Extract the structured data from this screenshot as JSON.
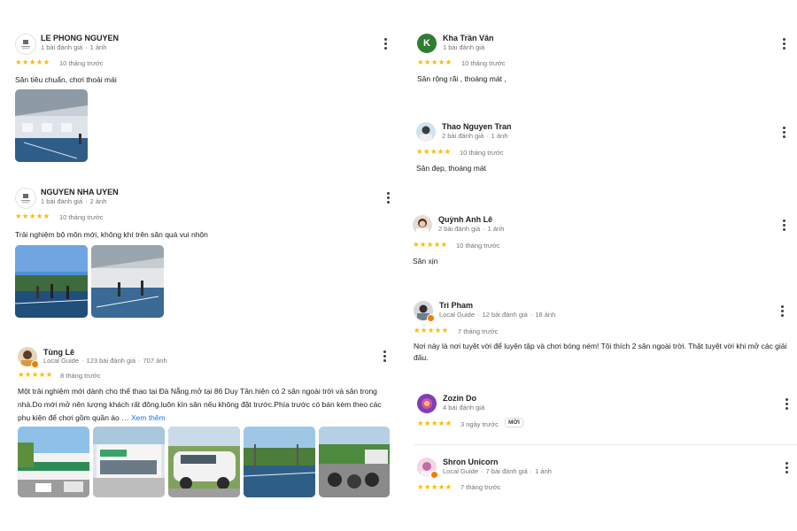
{
  "reviews": [
    {
      "name": "LE PHONG NGUYEN",
      "meta_a": "1 bài đánh giá",
      "meta_b": "1 ảnh",
      "time": "10 tháng trước",
      "stars": "★★★★★",
      "text": "Sân tiêu chuẩn, chơi thoải mái"
    },
    {
      "name": "NGUYEN NHA UYEN",
      "meta_a": "1 bài đánh giá",
      "meta_b": "2 ảnh",
      "time": "10 tháng trước",
      "stars": "★★★★★",
      "text": "Trải nghiệm bộ môn mới, không khí trên sân quá vui nhộn"
    },
    {
      "name": "Tùng Lê",
      "meta_a": "Local Guide",
      "meta_b": "123 bài đánh giá",
      "meta_c": "707 ảnh",
      "time": "8 tháng trước",
      "stars": "★★★★★",
      "text": "Một trải nghiệm mới dành cho thể thao tại Đà Nẵng.mở tại 86 Duy Tân.hiện có 2 sân ngoài trời và sân trong nhà.Do mới mở nên lượng khách rất đông.luôn kín sân nếu không đặt trước.Phía trước có bán kèm theo các phụ kiện để chơi gồm quần áo …",
      "more": "Xem thêm"
    },
    {
      "name": "Kha Trần Văn",
      "avatar_letter": "K",
      "meta_a": "1 bài đánh giá",
      "time": "10 tháng trước",
      "stars": "★★★★★",
      "text": "Sân rộng rãi , thoáng mát ,"
    },
    {
      "name": "Thao Nguyen Tran",
      "meta_a": "2 bài đánh giá",
      "meta_b": "1 ảnh",
      "time": "10 tháng trước",
      "stars": "★★★★★",
      "text": "Sân đẹp, thoáng mát"
    },
    {
      "name": "Quỳnh Anh Lê",
      "meta_a": "2 bài đánh giá",
      "meta_b": "1 ảnh",
      "time": "10 tháng trước",
      "stars": "★★★★★",
      "text": "Sân xịn"
    },
    {
      "name": "Tri Pham",
      "meta_a": "Local Guide",
      "meta_b": "12 bài đánh giá",
      "meta_c": "18 ảnh",
      "time": "7 tháng trước",
      "stars": "★★★★★",
      "text": "Nơi này là nơi tuyệt vời để luyện tập và chơi bóng ném! Tôi thích 2 sân ngoài trời. Thật tuyệt vời khi mở các giải đấu."
    },
    {
      "name": "Zozin Do",
      "meta_a": "4 bài đánh giá",
      "time": "3 ngày trước",
      "stars": "★★★★★",
      "badge": "MỚI"
    },
    {
      "name": "Shron Unicorn",
      "meta_a": "Local Guide",
      "meta_b": "7 bài đánh giá",
      "meta_c": "1 ảnh",
      "time": "7 tháng trước",
      "stars": "★★★★★"
    }
  ],
  "colors": {
    "star": "#fbbc04",
    "link": "#1a73e8",
    "local_guide_badge": "#f57c00",
    "avatar_k": "#2e7d32"
  },
  "icons": {
    "menu": "more-vert-icon",
    "star": "star-icon"
  }
}
